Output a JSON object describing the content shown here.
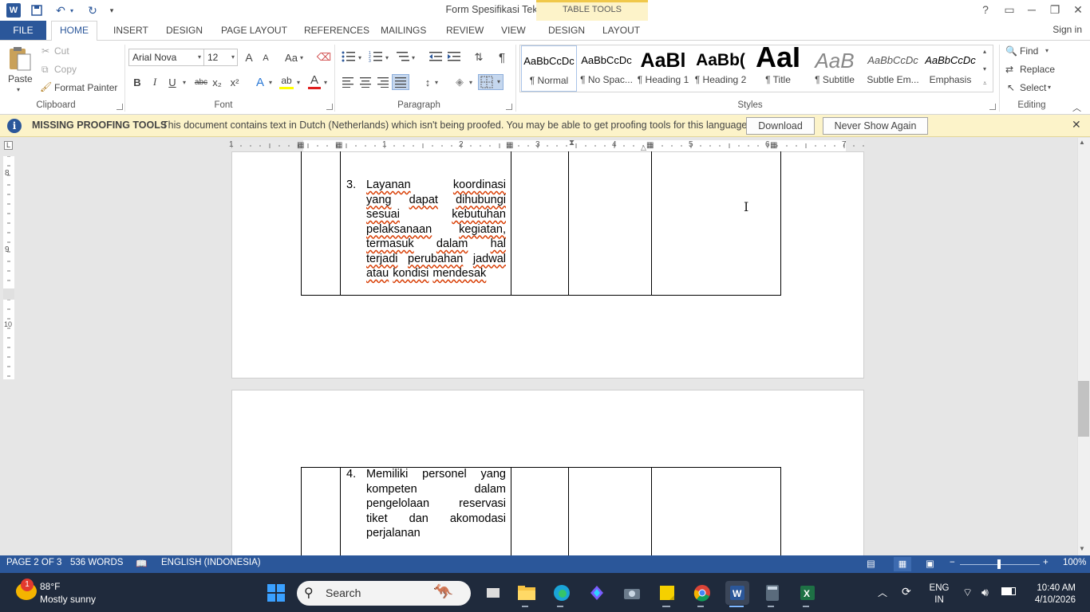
{
  "window": {
    "title": "Form Spesifikasi Teknis Jasa Lainnya - Word",
    "contextual_tab_group": "TABLE TOOLS",
    "controls": {
      "help": "?",
      "ribbon_display": "▭",
      "minimize": "─",
      "restore": "❐",
      "close": "✕"
    }
  },
  "tabs": {
    "file": "FILE",
    "home": "HOME",
    "insert": "INSERT",
    "design": "DESIGN",
    "page_layout": "PAGE LAYOUT",
    "references": "REFERENCES",
    "mailings": "MAILINGS",
    "review": "REVIEW",
    "view": "VIEW",
    "table_design": "DESIGN",
    "table_layout": "LAYOUT",
    "sign_in": "Sign in"
  },
  "clipboard": {
    "paste": "Paste",
    "cut": "Cut",
    "copy": "Copy",
    "format_painter": "Format Painter",
    "label": "Clipboard"
  },
  "font": {
    "name": "Arial Nova",
    "size": "12",
    "label": "Font",
    "bold": "B",
    "italic": "I",
    "underline": "U",
    "strikethrough": "abc",
    "subscript": "x₂",
    "superscript": "x²",
    "grow": "A",
    "shrink": "A",
    "change_case": "Aa",
    "text_effects": "A",
    "highlight": "ab",
    "font_color": "A"
  },
  "paragraph": {
    "label": "Paragraph",
    "show_marks": "¶"
  },
  "styles": {
    "label": "Styles",
    "items": [
      {
        "sample": "AaBbCcDc",
        "name": "¶ Normal"
      },
      {
        "sample": "AaBbCcDc",
        "name": "¶ No Spac..."
      },
      {
        "sample": "AaBl",
        "name": "¶ Heading 1"
      },
      {
        "sample": "AaBb(",
        "name": "¶ Heading 2"
      },
      {
        "sample": "AaI",
        "name": "¶ Title"
      },
      {
        "sample": "AaB",
        "name": "¶ Subtitle"
      },
      {
        "sample": "AaBbCcDc",
        "name": "Subtle Em..."
      },
      {
        "sample": "AaBbCcDc",
        "name": "Emphasis"
      }
    ]
  },
  "editing": {
    "label": "Editing",
    "find": "Find",
    "replace": "Replace",
    "select": "Select"
  },
  "message_bar": {
    "title": "MISSING PROOFING TOOLS",
    "text": "This document contains text in Dutch (Netherlands) which isn't being proofed. You may be able to get proofing tools for this language.",
    "download": "Download",
    "never_show": "Never Show Again",
    "info_glyph": "i",
    "close_glyph": "✕"
  },
  "ruler": {
    "h_numbers": [
      "1",
      "1",
      "2",
      "3",
      "4",
      "5",
      "6",
      "7"
    ],
    "v_numbers": [
      "8",
      "9",
      "10"
    ]
  },
  "document": {
    "item3_number": "3.",
    "item3_lines": [
      [
        "Layanan",
        "koordinasi"
      ],
      [
        "yang",
        "dapat",
        "dihubungi"
      ],
      [
        "sesuai",
        "kebutuhan"
      ],
      [
        "pelaksanaan",
        "kegiatan,"
      ],
      [
        "termasuk",
        "dalam",
        "hal"
      ],
      [
        "terjadi",
        "perubahan",
        "jadwal"
      ],
      [
        "atau",
        "kondisi",
        "mendesak"
      ]
    ],
    "item4_number": "4.",
    "item4_lines": [
      [
        "Memiliki",
        "personel",
        "yang"
      ],
      [
        "kompeten",
        "dalam"
      ],
      [
        "pengelolaan",
        "reservasi"
      ],
      [
        "tiket",
        "dan",
        "akomodasi"
      ],
      [
        "perjalanan"
      ]
    ]
  },
  "status": {
    "page": "PAGE 2 OF 3",
    "words": "536 WORDS",
    "language": "ENGLISH (INDONESIA)",
    "zoom": "100%",
    "zoom_minus": "−",
    "zoom_plus": "+"
  },
  "taskbar": {
    "weather_temp": "88°F",
    "weather_desc": "Mostly sunny",
    "weather_badge": "1",
    "search_placeholder": "Search",
    "language": "ENG",
    "region": "IN",
    "time": "10:40 AM",
    "date": "4/10/2026"
  },
  "colors": {
    "accent": "#2b579a",
    "message_bar": "#fcf3c9",
    "spell_underline": "#d83b01"
  }
}
